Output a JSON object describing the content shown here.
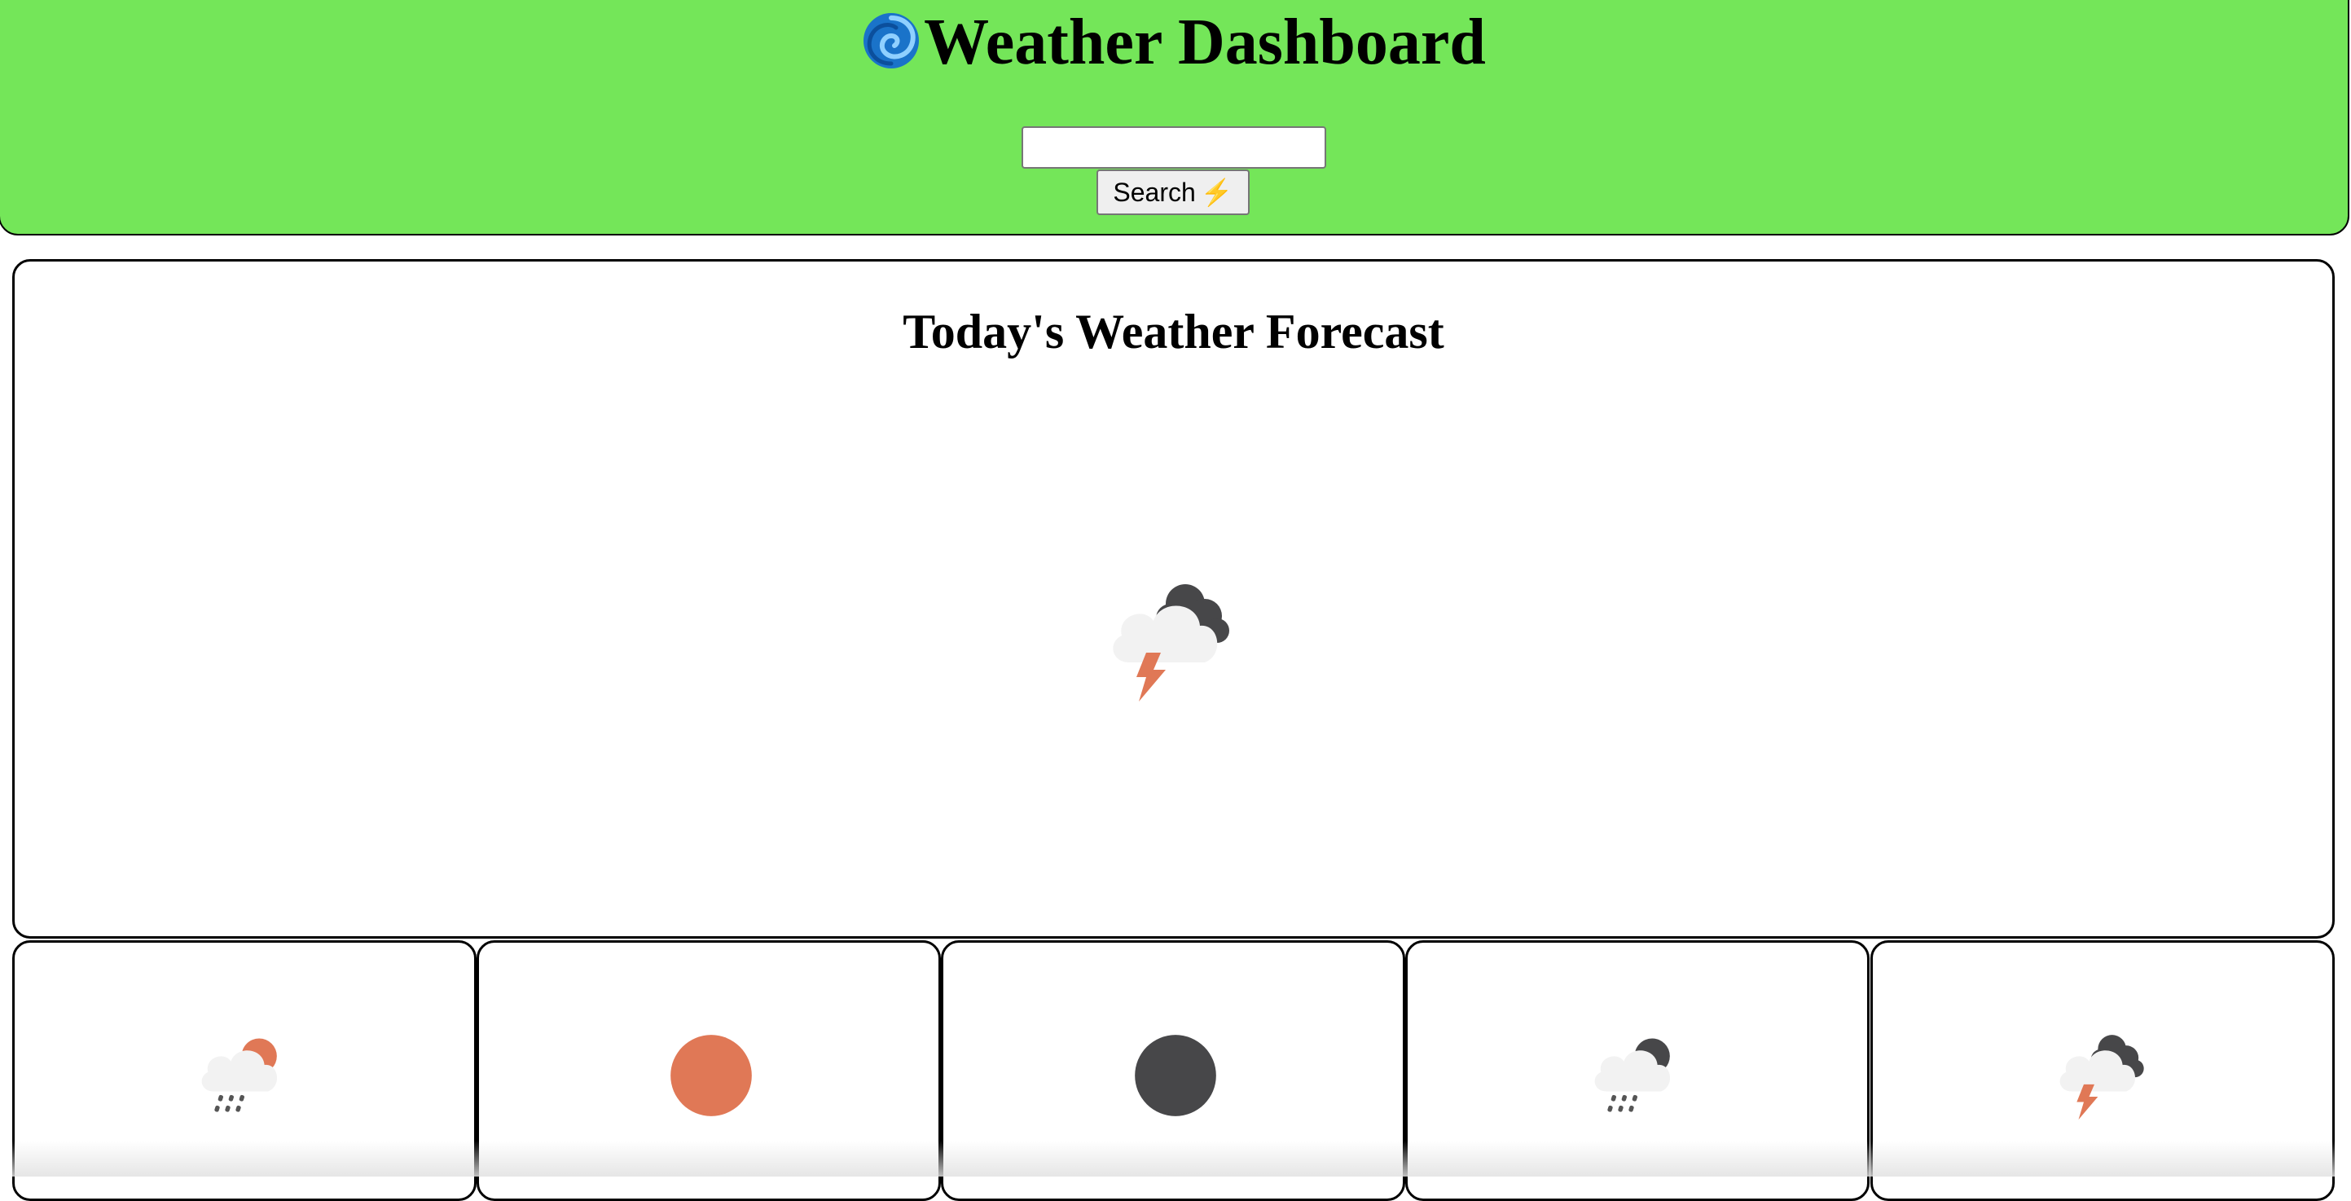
{
  "header": {
    "title": "Weather Dashboard",
    "title_icon": "cyclone-icon",
    "background_color": "#74e659"
  },
  "search": {
    "value": "",
    "placeholder": "",
    "button_label": "Search",
    "button_icon": "⚡"
  },
  "today": {
    "heading": "Today's Weather Forecast",
    "icon": "thunderstorm-night-icon"
  },
  "forecast": [
    {
      "icon": "rain-day-icon"
    },
    {
      "icon": "clear-day-sun-icon"
    },
    {
      "icon": "clear-night-moon-icon"
    },
    {
      "icon": "rain-night-icon"
    },
    {
      "icon": "thunderstorm-night-icon"
    }
  ],
  "colors": {
    "sun": "#e07856",
    "moon": "#474749",
    "cloud": "#f2f2f2",
    "lightning": "#e07856",
    "rain": "#555555"
  }
}
